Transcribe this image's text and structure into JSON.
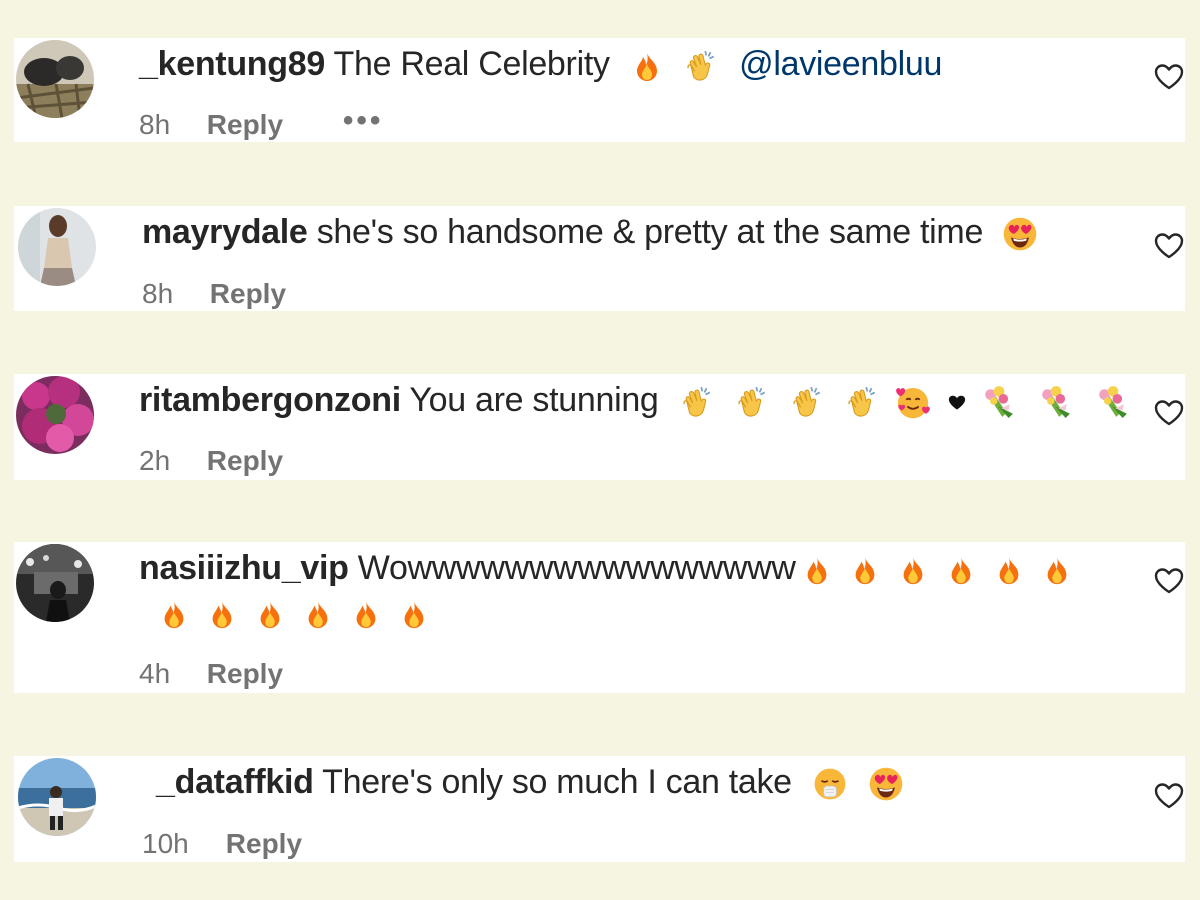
{
  "comments": [
    {
      "username": "_kentung89",
      "text": "The Real Celebrity",
      "mention": "@lavieenbluu",
      "emojis": [
        "fire-emoji",
        "clap-emoji"
      ],
      "time": "8h",
      "reply_label": "Reply",
      "more_label": "•••"
    },
    {
      "username": "mayrydale",
      "text": "she's so handsome & pretty at the same time",
      "emojis": [
        "heart-eyes-emoji"
      ],
      "time": "8h",
      "reply_label": "Reply"
    },
    {
      "username": "ritambergonzoni",
      "text": "You are stunning",
      "emojis": [
        "clap-emoji",
        "clap-emoji",
        "clap-emoji",
        "clap-emoji",
        "smiling-hearts-emoji",
        "black-heart-emoji",
        "bouquet-emoji",
        "bouquet-emoji",
        "bouquet-emoji"
      ],
      "time": "2h",
      "reply_label": "Reply"
    },
    {
      "username": "nasiiizhu_vip",
      "text": "Wowwwwwwwwwwwwwwww",
      "emojis": [
        "fire-emoji",
        "fire-emoji",
        "fire-emoji",
        "fire-emoji",
        "fire-emoji",
        "fire-emoji",
        "fire-emoji",
        "fire-emoji",
        "fire-emoji",
        "fire-emoji",
        "fire-emoji",
        "fire-emoji"
      ],
      "time": "4h",
      "reply_label": "Reply"
    },
    {
      "username": "_dataffkid",
      "text": "There's only so much I can take",
      "emojis": [
        "relieved-sneeze-emoji",
        "heart-eyes-emoji"
      ],
      "time": "10h",
      "reply_label": "Reply"
    }
  ],
  "icons": {
    "like": "heart-outline-icon"
  },
  "colors": {
    "background": "#f5f5e1",
    "card": "#ffffff",
    "username": "#262626",
    "meta": "#737373",
    "mention": "#00376b"
  }
}
